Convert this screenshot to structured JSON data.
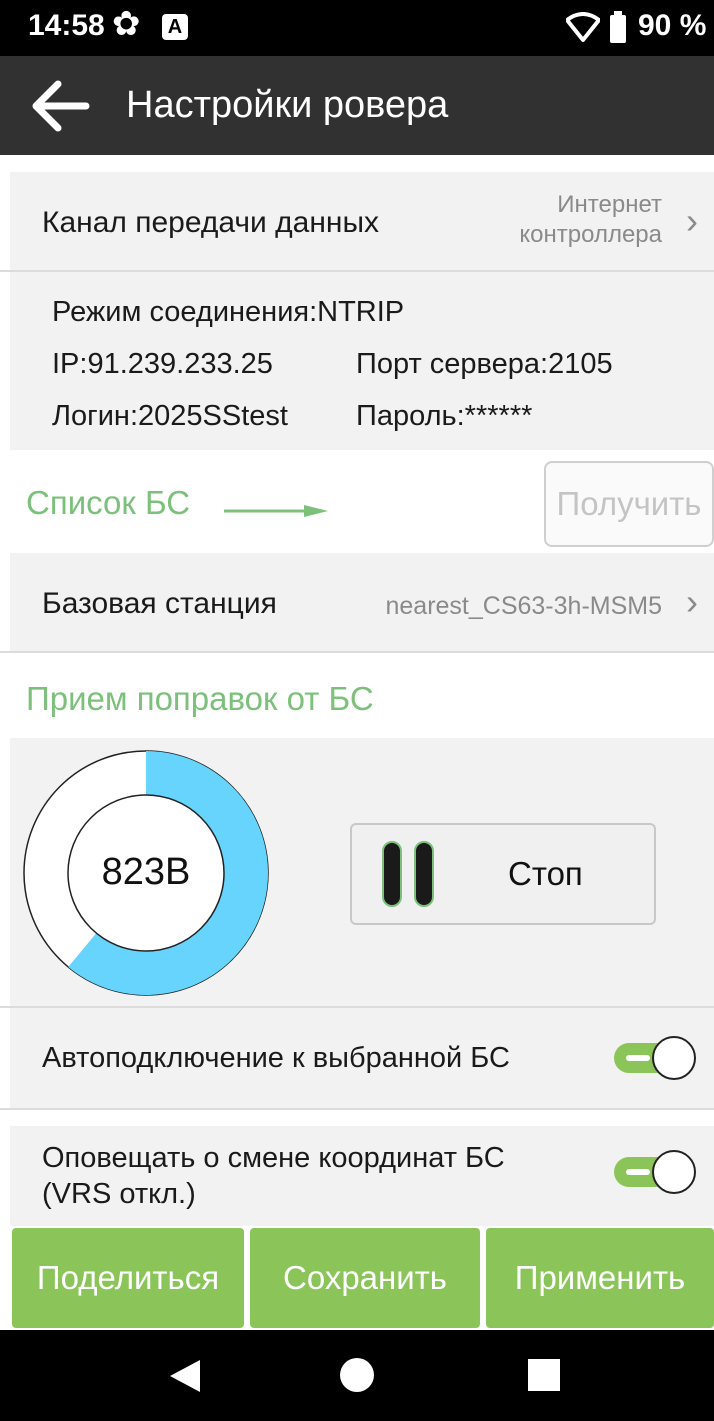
{
  "status_bar": {
    "time": "14:58",
    "battery_percent": "90 %",
    "settings_icon": "gear-icon",
    "notification_icon": "a-icon"
  },
  "app_bar": {
    "title": "Настройки ровера",
    "back_icon": "arrow-left-icon"
  },
  "data_channel": {
    "label": "Канал передачи данных",
    "value_line1": "Интернет",
    "value_line2": "контроллера"
  },
  "connection_info": {
    "mode": "Режим соединения:NTRIP",
    "ip": "IP:91.239.233.25",
    "port": "Порт сервера:2105",
    "login": "Логин:2025SStest",
    "password": "Пароль:******"
  },
  "bs_list": {
    "label": "Список БС",
    "get_button": "Получить"
  },
  "base_station": {
    "label": "Базовая станция",
    "value": "nearest_CS63-3h-MSM5"
  },
  "corrections": {
    "title": "Прием поправок от БС",
    "received": "823B",
    "donut_fill_fraction": 0.61,
    "donut_color": "#66d4fc",
    "stop_button": "Стоп"
  },
  "toggles": [
    {
      "label": "Автоподключение к выбранной БС",
      "checked": true
    },
    {
      "label_line1": "Оповещать о смене координат БС",
      "label_line2": "(VRS откл.)",
      "checked": true
    }
  ],
  "footer": {
    "share": "Поделиться",
    "save": "Сохранить",
    "apply": "Применить"
  },
  "colors": {
    "accent_green": "#8bc55a",
    "title_green": "#7cc07c",
    "app_bar": "#313131"
  }
}
